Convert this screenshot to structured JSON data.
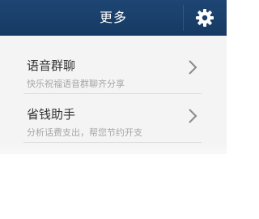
{
  "header": {
    "title": "更多",
    "settings_icon": "gear-icon",
    "background_color": "#1a3f6b"
  },
  "menu": {
    "items": [
      {
        "title": "语音群聊",
        "subtitle": "快乐祝福语音群聊齐分享",
        "icon": "chevron-right-icon"
      },
      {
        "title": "省钱助手",
        "subtitle": "分析话费支出，帮您节约开支",
        "icon": "chevron-right-icon"
      }
    ]
  }
}
